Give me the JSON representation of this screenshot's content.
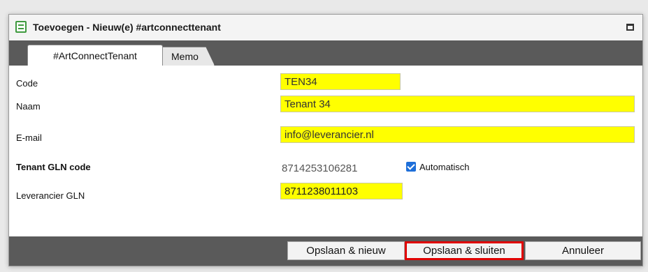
{
  "window": {
    "title": "Toevoegen - Nieuw(e) #artconnecttenant",
    "icon": "form-icon",
    "maximize_icon": "maximize-icon"
  },
  "tabs": [
    {
      "label": "#ArtConnectTenant",
      "active": true
    },
    {
      "label": "Memo",
      "active": false
    }
  ],
  "form": {
    "code": {
      "label": "Code",
      "value": "TEN34"
    },
    "naam": {
      "label": "Naam",
      "value": "Tenant 34"
    },
    "email": {
      "label": "E-mail",
      "value": "info@leverancier.nl"
    },
    "tenant_gln": {
      "label": "Tenant GLN code",
      "value": "8714253106281"
    },
    "automatisch": {
      "label": "Automatisch",
      "checked": true
    },
    "leverancier_gln": {
      "label": "Leverancier GLN",
      "value": "8711238011103"
    }
  },
  "footer": {
    "save_new": "Opslaan & nieuw",
    "save_close": "Opslaan & sluiten",
    "cancel": "Annuleer"
  },
  "colors": {
    "field_highlight": "#ffff00",
    "bar_dark": "#5a5a5a",
    "focus_outline": "#e00000",
    "checkbox": "#1e6fd9"
  }
}
